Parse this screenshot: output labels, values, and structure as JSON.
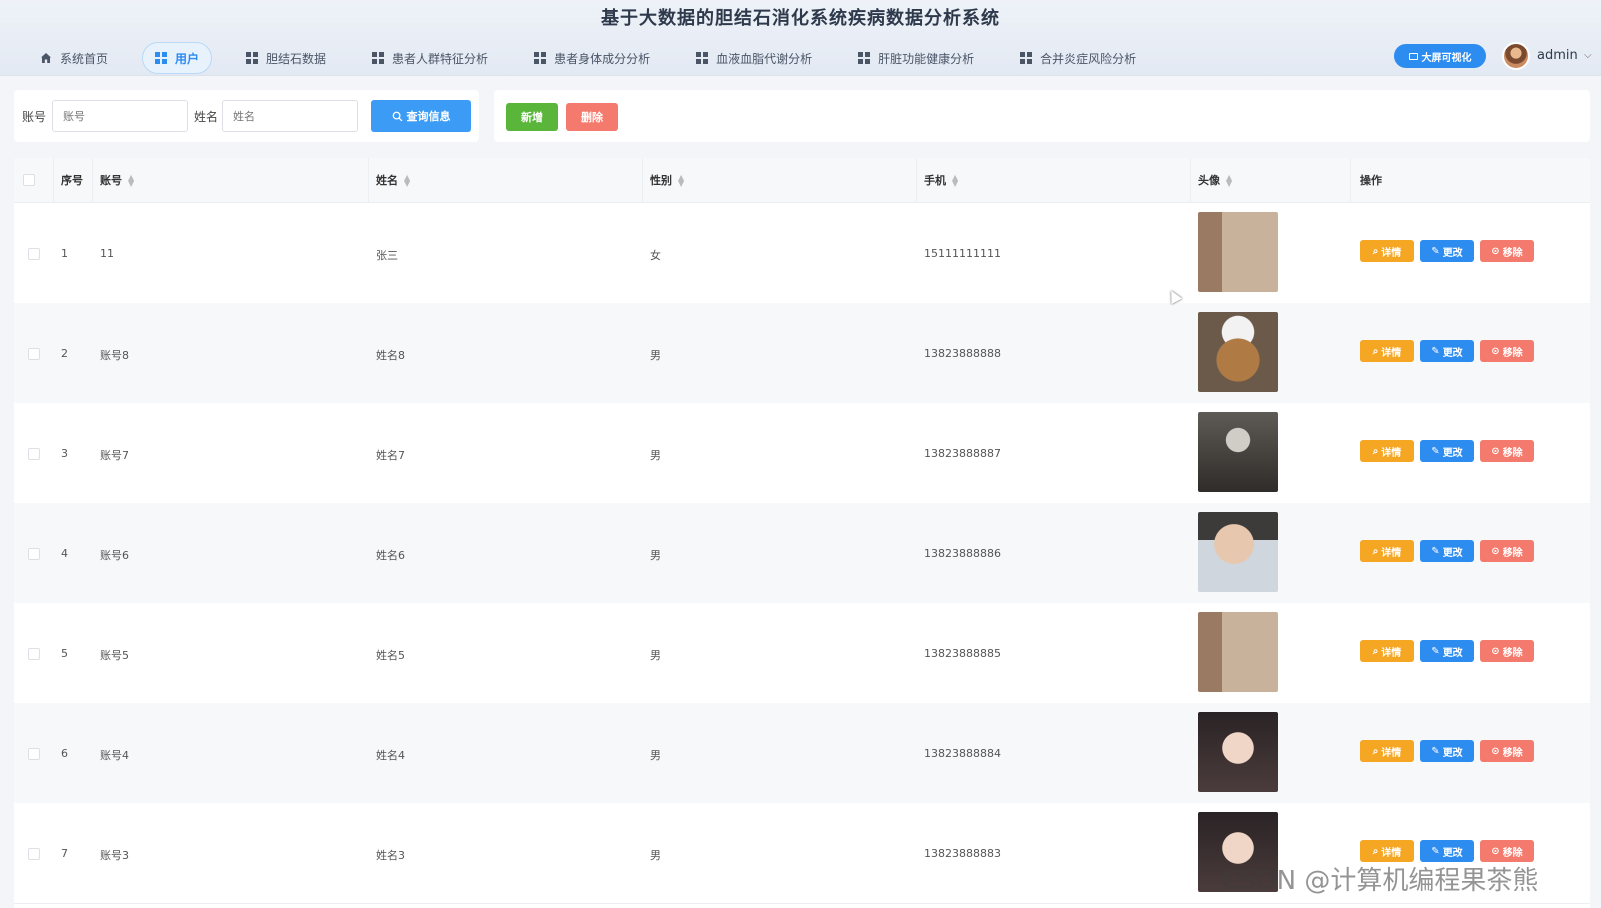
{
  "app": {
    "title": "基于大数据的胆结石消化系统疾病数据分析系统"
  },
  "nav": [
    {
      "label": "系统首页",
      "icon": "home-icon",
      "active": false
    },
    {
      "label": "用户",
      "icon": "grid-icon",
      "active": true
    },
    {
      "label": "胆结石数据",
      "icon": "grid-icon",
      "active": false
    },
    {
      "label": "患者人群特征分析",
      "icon": "grid-icon",
      "active": false
    },
    {
      "label": "患者身体成分分析",
      "icon": "grid-icon",
      "active": false
    },
    {
      "label": "血液血脂代谢分析",
      "icon": "grid-icon",
      "active": false
    },
    {
      "label": "肝脏功能健康分析",
      "icon": "grid-icon",
      "active": false
    },
    {
      "label": "合并炎症风险分析",
      "icon": "grid-icon",
      "active": false
    }
  ],
  "header": {
    "bigscreen_label": "大屏可视化",
    "username": "admin",
    "caret": "⌵"
  },
  "search": {
    "account_label": "账号",
    "account_placeholder": "账号",
    "account_value": "",
    "name_label": "姓名",
    "name_placeholder": "姓名",
    "name_value": "",
    "query_label": "查询信息"
  },
  "actions": {
    "add_label": "新增",
    "delete_label": "删除"
  },
  "table": {
    "columns": [
      "序号",
      "账号",
      "姓名",
      "性别",
      "手机",
      "头像",
      "操作"
    ],
    "row_actions": {
      "detail": "详情",
      "edit": "更改",
      "remove": "移除"
    },
    "rows": [
      {
        "index": "1",
        "account": "11",
        "name": "张三",
        "gender": "女",
        "phone": "15111111111",
        "avatar": "woman-street-photo"
      },
      {
        "index": "2",
        "account": "账号8",
        "name": "姓名8",
        "gender": "男",
        "phone": "13823888888",
        "avatar": "cat-with-hat-photo"
      },
      {
        "index": "3",
        "account": "账号7",
        "name": "姓名7",
        "gender": "男",
        "phone": "13823888887",
        "avatar": "man-mono-photo"
      },
      {
        "index": "4",
        "account": "账号6",
        "name": "姓名6",
        "gender": "男",
        "phone": "13823888886",
        "avatar": "man-closeup-photo"
      },
      {
        "index": "5",
        "account": "账号5",
        "name": "姓名5",
        "gender": "男",
        "phone": "13823888885",
        "avatar": "woman-street-photo"
      },
      {
        "index": "6",
        "account": "账号4",
        "name": "姓名4",
        "gender": "男",
        "phone": "13823888884",
        "avatar": "woman-portrait-photo"
      },
      {
        "index": "7",
        "account": "账号3",
        "name": "姓名3",
        "gender": "男",
        "phone": "13823888883",
        "avatar": "woman-portrait-photo"
      }
    ]
  },
  "watermark": "CSDN @计算机编程果茶熊",
  "colors": {
    "primary": "#2d8cf0",
    "success": "#5ab53b",
    "danger": "#f37a6d",
    "warning": "#f5a623"
  }
}
